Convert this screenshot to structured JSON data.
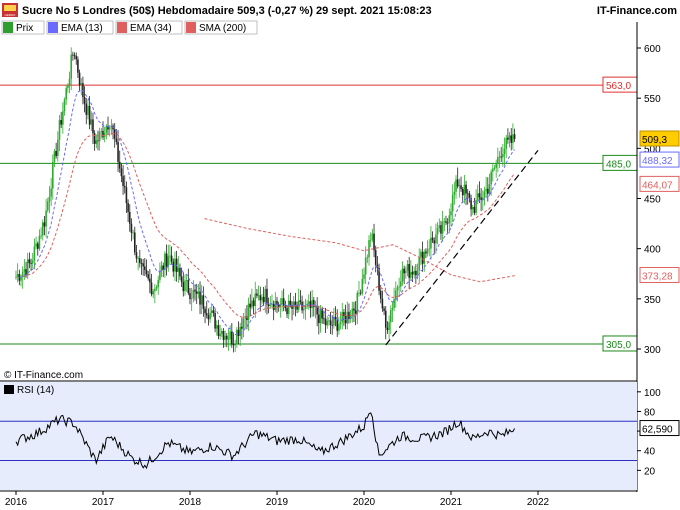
{
  "header": {
    "title": "Sucre No 5 Londres (50$) Hebdomadaire 509,3 (-0,27 %) 29 sept. 2021 15:08:23",
    "brand": "IT-Finance.com",
    "logo_text": "HEBDO"
  },
  "legend": [
    {
      "label": "Prix",
      "color": "#2e9e2e"
    },
    {
      "label": "EMA (13)",
      "color": "#6a6aff"
    },
    {
      "label": "EMA (34)",
      "color": "#e06060"
    },
    {
      "label": "SMA (200)",
      "color": "#e06060"
    }
  ],
  "copyright": "© IT-Finance.com",
  "colors": {
    "up": "#2eaa2e",
    "down": "#222222",
    "ema13": "#6a6aff",
    "ema34": "#e06060",
    "sma200": "#e06060",
    "resistance": "#e03030",
    "support": "#1a8a1a",
    "rsi_line": "#000000",
    "rsi_band": "#3030c0",
    "rsi_bg": "#e6ecfc"
  },
  "chart_data": [
    {
      "type": "candlestick",
      "title": "Sucre No 5 Londres (50$) Hebdomadaire",
      "x_ticks": [
        "2016",
        "2017",
        "2018",
        "2019",
        "2020",
        "2021",
        "2022"
      ],
      "y_ticks": [
        300,
        350,
        400,
        450,
        500,
        550,
        600
      ],
      "ylim": [
        296,
        628
      ],
      "price_path": [
        [
          "2016-01",
          372
        ],
        [
          "2016-03",
          385
        ],
        [
          "2016-05",
          430
        ],
        [
          "2016-07",
          520
        ],
        [
          "2016-09",
          600
        ],
        [
          "2016-10",
          560
        ],
        [
          "2016-12",
          505
        ],
        [
          "2017-02",
          530
        ],
        [
          "2017-04",
          455
        ],
        [
          "2017-06",
          380
        ],
        [
          "2017-08",
          360
        ],
        [
          "2017-10",
          395
        ],
        [
          "2017-12",
          365
        ],
        [
          "2018-03",
          345
        ],
        [
          "2018-05",
          320
        ],
        [
          "2018-07",
          310
        ],
        [
          "2018-09",
          340
        ],
        [
          "2018-11",
          355
        ],
        [
          "2019-01",
          345
        ],
        [
          "2019-03",
          340
        ],
        [
          "2019-06",
          340
        ],
        [
          "2019-08",
          323
        ],
        [
          "2019-10",
          328
        ],
        [
          "2019-12",
          345
        ],
        [
          "2020-02",
          415
        ],
        [
          "2020-04",
          320
        ],
        [
          "2020-06",
          375
        ],
        [
          "2020-08",
          380
        ],
        [
          "2020-10",
          405
        ],
        [
          "2020-12",
          420
        ],
        [
          "2021-02",
          468
        ],
        [
          "2021-04",
          440
        ],
        [
          "2021-06",
          460
        ],
        [
          "2021-08",
          500
        ],
        [
          "2021-09-29",
          509.3
        ]
      ],
      "series": [
        {
          "name": "Prix"
        },
        {
          "name": "EMA (13)",
          "last": 488.32
        },
        {
          "name": "EMA (34)",
          "last": 464.07
        },
        {
          "name": "SMA (200)",
          "last": 373.28,
          "points": [
            [
              "2018-03",
              430
            ],
            [
              "2018-09",
              420
            ],
            [
              "2019-03",
              412
            ],
            [
              "2019-09",
              406
            ],
            [
              "2020-01",
              398
            ],
            [
              "2020-05",
              404
            ],
            [
              "2020-09",
              390
            ],
            [
              "2021-01",
              374
            ],
            [
              "2021-05",
              367
            ],
            [
              "2021-09-29",
              373.28
            ]
          ]
        }
      ],
      "price_label": "509,3",
      "last_labels": {
        "ema13": "488,32",
        "ema34": "464,07",
        "sma200": "373,28"
      },
      "horizontal_lines": [
        {
          "value": 563.0,
          "label": "563,0",
          "kind": "resistance"
        },
        {
          "value": 485.0,
          "label": "485,0",
          "kind": "support"
        },
        {
          "value": 305.0,
          "label": "305,0",
          "kind": "support"
        }
      ],
      "trendline": {
        "from": [
          "2020-04",
          304
        ],
        "to": [
          "2022-01",
          498
        ],
        "style": "dashed"
      }
    },
    {
      "type": "line",
      "title": "RSI (14)",
      "y_ticks": [
        20,
        40,
        60,
        80,
        100
      ],
      "ylim": [
        0,
        110
      ],
      "bands": [
        70,
        30
      ],
      "last": 62.59,
      "last_label": "62,590",
      "rsi_path": [
        [
          "2016-01",
          50
        ],
        [
          "2016-04",
          58
        ],
        [
          "2016-07",
          72
        ],
        [
          "2016-09",
          68
        ],
        [
          "2016-12",
          30
        ],
        [
          "2017-02",
          55
        ],
        [
          "2017-05",
          32
        ],
        [
          "2017-07",
          26
        ],
        [
          "2017-10",
          48
        ],
        [
          "2018-01",
          38
        ],
        [
          "2018-04",
          45
        ],
        [
          "2018-07",
          35
        ],
        [
          "2018-10",
          58
        ],
        [
          "2019-01",
          50
        ],
        [
          "2019-04",
          52
        ],
        [
          "2019-07",
          38
        ],
        [
          "2019-10",
          50
        ],
        [
          "2020-01",
          65
        ],
        [
          "2020-02",
          85
        ],
        [
          "2020-03",
          35
        ],
        [
          "2020-06",
          55
        ],
        [
          "2020-09",
          52
        ],
        [
          "2020-12",
          58
        ],
        [
          "2021-02",
          70
        ],
        [
          "2021-04",
          52
        ],
        [
          "2021-06",
          60
        ],
        [
          "2021-08",
          55
        ],
        [
          "2021-09-29",
          62.59
        ]
      ]
    }
  ]
}
